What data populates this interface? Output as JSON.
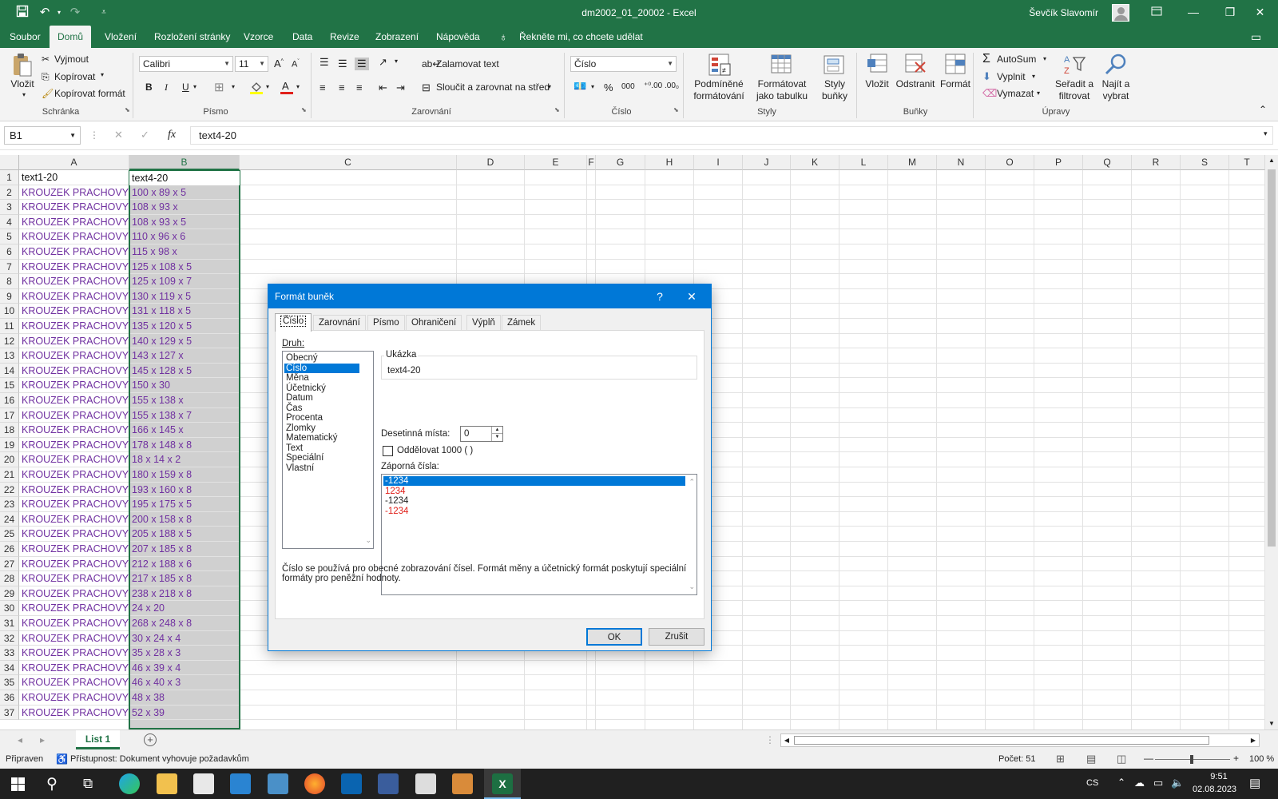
{
  "window": {
    "title": "dm2002_01_20002  -  Excel",
    "user": "Ševčík Slavomír"
  },
  "menu": {
    "items": [
      "Soubor",
      "Domů",
      "Vložení",
      "Rozložení stránky",
      "Vzorce",
      "Data",
      "Revize",
      "Zobrazení",
      "Nápověda"
    ],
    "tell_me": "Řekněte mi, co chcete udělat"
  },
  "ribbon": {
    "clipboard": {
      "paste": "Vložit",
      "cut": "Vyjmout",
      "copy": "Kopírovat",
      "format_painter": "Kopírovat formát",
      "label": "Schránka"
    },
    "font": {
      "name": "Calibri",
      "size": "11",
      "bold": "B",
      "italic": "I",
      "underline": "U",
      "label": "Písmo"
    },
    "alignment": {
      "wrap": "Zalamovat text",
      "merge": "Sloučit a zarovnat na střed",
      "label": "Zarovnání"
    },
    "number": {
      "format": "Číslo",
      "percent": "%",
      "thousands": "000",
      "label": "Číslo"
    },
    "styles": {
      "conditional": "Podmíněné formátování",
      "table": "Formátovat jako tabulku",
      "cell_styles": "Styly buňky",
      "label": "Styly"
    },
    "cells": {
      "insert": "Vložit",
      "delete": "Odstranit",
      "format": "Formát",
      "label": "Buňky"
    },
    "editing": {
      "autosum": "AutoSum",
      "fill": "Vyplnit",
      "clear": "Vymazat",
      "sort": "Seřadit a filtrovat",
      "find": "Najít a vybrat",
      "label": "Úpravy"
    }
  },
  "formula_bar": {
    "name_box": "B1",
    "fx": "fx",
    "value": "text4-20"
  },
  "columns": [
    "A",
    "B",
    "C",
    "D",
    "E",
    "F",
    "G",
    "H",
    "I",
    "J",
    "K",
    "L",
    "M",
    "N",
    "O",
    "P",
    "Q",
    "R",
    "S",
    "T"
  ],
  "rows": [
    {
      "n": "1",
      "a": "text1-20",
      "b": "text4-20"
    },
    {
      "n": "2",
      "a": "KROUZEK PRACHOVY",
      "b": "100 x 89 x 5"
    },
    {
      "n": "3",
      "a": "KROUZEK PRACHOVY",
      "b": "108 x 93 x"
    },
    {
      "n": "4",
      "a": "KROUZEK PRACHOVY",
      "b": "108 x 93 x 5"
    },
    {
      "n": "5",
      "a": "KROUZEK PRACHOVY",
      "b": "110 x 96 x 6"
    },
    {
      "n": "6",
      "a": "KROUZEK PRACHOVY",
      "b": "115 x 98 x"
    },
    {
      "n": "7",
      "a": "KROUZEK PRACHOVY",
      "b": "125 x 108 x 5"
    },
    {
      "n": "8",
      "a": "KROUZEK PRACHOVY",
      "b": "125 x 109 x 7"
    },
    {
      "n": "9",
      "a": "KROUZEK PRACHOVY",
      "b": "130 x 119 x 5"
    },
    {
      "n": "10",
      "a": "KROUZEK PRACHOVY",
      "b": "131 x 118 x 5"
    },
    {
      "n": "11",
      "a": "KROUZEK PRACHOVY",
      "b": "135 x 120 x 5"
    },
    {
      "n": "12",
      "a": "KROUZEK PRACHOVY",
      "b": "140 x 129 x 5"
    },
    {
      "n": "13",
      "a": "KROUZEK PRACHOVY",
      "b": "143 x 127 x"
    },
    {
      "n": "14",
      "a": "KROUZEK PRACHOVY",
      "b": "145 x 128 x 5"
    },
    {
      "n": "15",
      "a": "KROUZEK PRACHOVY",
      "b": "150 x 30"
    },
    {
      "n": "16",
      "a": "KROUZEK PRACHOVY",
      "b": "155 x 138 x"
    },
    {
      "n": "17",
      "a": "KROUZEK PRACHOVY",
      "b": "155 x 138 x 7"
    },
    {
      "n": "18",
      "a": "KROUZEK PRACHOVY",
      "b": "166 x 145 x"
    },
    {
      "n": "19",
      "a": "KROUZEK PRACHOVY",
      "b": "178 x 148 x 8"
    },
    {
      "n": "20",
      "a": "KROUZEK PRACHOVY",
      "b": "18 x 14 x 2"
    },
    {
      "n": "21",
      "a": "KROUZEK PRACHOVY",
      "b": "180 x 159 x 8"
    },
    {
      "n": "22",
      "a": "KROUZEK PRACHOVY",
      "b": "193 x 160 x 8"
    },
    {
      "n": "23",
      "a": "KROUZEK PRACHOVY",
      "b": "195 x 175 x 5"
    },
    {
      "n": "24",
      "a": "KROUZEK PRACHOVY",
      "b": "200 x 158 x 8"
    },
    {
      "n": "25",
      "a": "KROUZEK PRACHOVY",
      "b": "205 x 188 x 5"
    },
    {
      "n": "26",
      "a": "KROUZEK PRACHOVY",
      "b": "207 x 185 x 8"
    },
    {
      "n": "27",
      "a": "KROUZEK PRACHOVY",
      "b": "212 x 188 x 6"
    },
    {
      "n": "28",
      "a": "KROUZEK PRACHOVY",
      "b": "217 x 185 x 8"
    },
    {
      "n": "29",
      "a": "KROUZEK PRACHOVY",
      "b": "238 x 218 x 8"
    },
    {
      "n": "30",
      "a": "KROUZEK PRACHOVY",
      "b": "24 x 20"
    },
    {
      "n": "31",
      "a": "KROUZEK PRACHOVY",
      "b": "268 x 248 x 8"
    },
    {
      "n": "32",
      "a": "KROUZEK PRACHOVY",
      "b": "30 x 24 x 4"
    },
    {
      "n": "33",
      "a": "KROUZEK PRACHOVY",
      "b": "35 x 28 x 3"
    },
    {
      "n": "34",
      "a": "KROUZEK PRACHOVY",
      "b": "46 x 39 x 4"
    },
    {
      "n": "35",
      "a": "KROUZEK PRACHOVY",
      "b": "46 x 40 x 3"
    },
    {
      "n": "36",
      "a": "KROUZEK PRACHOVY",
      "b": "48 x 38"
    },
    {
      "n": "37",
      "a": "KROUZEK PRACHOVY",
      "b": "52 x 39"
    }
  ],
  "sheet": {
    "tab": "List 1",
    "add": "+"
  },
  "status": {
    "ready": "Připraven",
    "accessibility": "Přístupnost: Dokument vyhovuje požadavkům",
    "count": "Počet: 51",
    "zoom": "100 %"
  },
  "taskbar": {
    "lang": "CS",
    "time": "9:51",
    "date": "02.08.2023"
  },
  "dialog": {
    "title": "Formát buněk",
    "help": "?",
    "close": "✕",
    "tabs": [
      "Číslo",
      "Zarovnání",
      "Písmo",
      "Ohraničení",
      "Výplň",
      "Zámek"
    ],
    "category_label": "Druh:",
    "categories": [
      "Obecný",
      "Číslo",
      "Měna",
      "Účetnický",
      "Datum",
      "Čas",
      "Procenta",
      "Zlomky",
      "Matematický",
      "Text",
      "Speciální",
      "Vlastní"
    ],
    "sample_label": "Ukázka",
    "sample_value": "text4-20",
    "decimals_label": "Desetinná místa:",
    "decimals_value": "0",
    "thousands_label": "Oddělovat 1000 ( )",
    "negative_label": "Záporná čísla:",
    "negatives": [
      "-1234",
      "1234",
      "-1234",
      "-1234"
    ],
    "description": "Číslo se používá pro obecné zobrazování čísel. Formát měny a účetnický formát poskytují speciální formáty pro peněžní hodnoty.",
    "ok": "OK",
    "cancel": "Zrušit"
  }
}
